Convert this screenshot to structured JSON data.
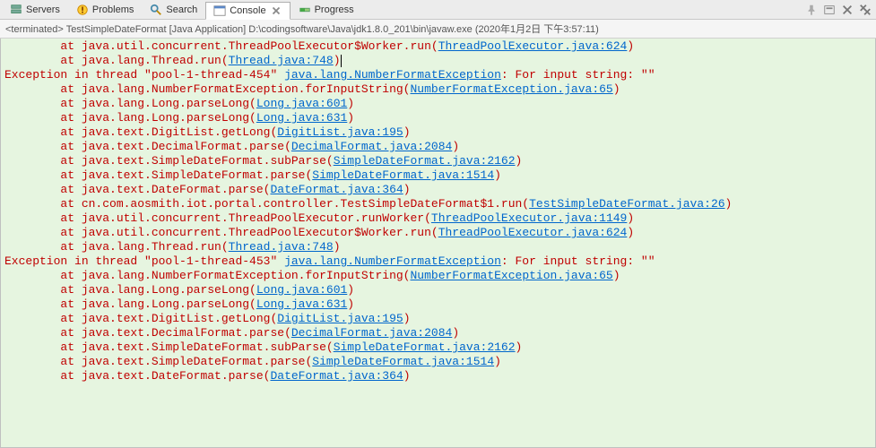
{
  "tabs": [
    {
      "label": "Servers"
    },
    {
      "label": "Problems"
    },
    {
      "label": "Search"
    },
    {
      "label": "Console"
    },
    {
      "label": "Progress"
    }
  ],
  "status": {
    "prefix": "<terminated> ",
    "name": "TestSimpleDateFormat [Java Application]",
    "path": " D:\\codingsoftware\\Java\\jdk1.8.0_201\\bin\\javaw.exe ",
    "time": "(2020年1月2日 下午3:57:11)"
  },
  "lines": [
    {
      "type": "at",
      "indent": 8,
      "method": "java.util.concurrent.ThreadPoolExecutor$Worker.run",
      "link": "ThreadPoolExecutor.java:624"
    },
    {
      "type": "at",
      "indent": 8,
      "method": "java.lang.Thread.run",
      "link": "Thread.java:748",
      "cursor": true
    },
    {
      "type": "ex",
      "thread": "pool-1-thread-454",
      "exClass": "java.lang.NumberFormatException",
      "msg": ": For input string: \"\""
    },
    {
      "type": "at",
      "indent": 8,
      "method": "java.lang.NumberFormatException.forInputString",
      "link": "NumberFormatException.java:65"
    },
    {
      "type": "at",
      "indent": 8,
      "method": "java.lang.Long.parseLong",
      "link": "Long.java:601"
    },
    {
      "type": "at",
      "indent": 8,
      "method": "java.lang.Long.parseLong",
      "link": "Long.java:631"
    },
    {
      "type": "at",
      "indent": 8,
      "method": "java.text.DigitList.getLong",
      "link": "DigitList.java:195"
    },
    {
      "type": "at",
      "indent": 8,
      "method": "java.text.DecimalFormat.parse",
      "link": "DecimalFormat.java:2084"
    },
    {
      "type": "at",
      "indent": 8,
      "method": "java.text.SimpleDateFormat.subParse",
      "link": "SimpleDateFormat.java:2162"
    },
    {
      "type": "at",
      "indent": 8,
      "method": "java.text.SimpleDateFormat.parse",
      "link": "SimpleDateFormat.java:1514"
    },
    {
      "type": "at",
      "indent": 8,
      "method": "java.text.DateFormat.parse",
      "link": "DateFormat.java:364"
    },
    {
      "type": "at",
      "indent": 8,
      "method": "cn.com.aosmith.iot.portal.controller.TestSimpleDateFormat$1.run",
      "link": "TestSimpleDateFormat.java:26"
    },
    {
      "type": "at",
      "indent": 8,
      "method": "java.util.concurrent.ThreadPoolExecutor.runWorker",
      "link": "ThreadPoolExecutor.java:1149"
    },
    {
      "type": "at",
      "indent": 8,
      "method": "java.util.concurrent.ThreadPoolExecutor$Worker.run",
      "link": "ThreadPoolExecutor.java:624"
    },
    {
      "type": "at",
      "indent": 8,
      "method": "java.lang.Thread.run",
      "link": "Thread.java:748"
    },
    {
      "type": "ex",
      "thread": "pool-1-thread-453",
      "exClass": "java.lang.NumberFormatException",
      "msg": ": For input string: \"\""
    },
    {
      "type": "at",
      "indent": 8,
      "method": "java.lang.NumberFormatException.forInputString",
      "link": "NumberFormatException.java:65"
    },
    {
      "type": "at",
      "indent": 8,
      "method": "java.lang.Long.parseLong",
      "link": "Long.java:601"
    },
    {
      "type": "at",
      "indent": 8,
      "method": "java.lang.Long.parseLong",
      "link": "Long.java:631"
    },
    {
      "type": "at",
      "indent": 8,
      "method": "java.text.DigitList.getLong",
      "link": "DigitList.java:195"
    },
    {
      "type": "at",
      "indent": 8,
      "method": "java.text.DecimalFormat.parse",
      "link": "DecimalFormat.java:2084"
    },
    {
      "type": "at",
      "indent": 8,
      "method": "java.text.SimpleDateFormat.subParse",
      "link": "SimpleDateFormat.java:2162"
    },
    {
      "type": "at",
      "indent": 8,
      "method": "java.text.SimpleDateFormat.parse",
      "link": "SimpleDateFormat.java:1514"
    },
    {
      "type": "at",
      "indent": 8,
      "method": "java.text.DateFormat.parse",
      "link": "DateFormat.java:364"
    }
  ],
  "labels": {
    "ex_prefix": "Exception in thread \"",
    "ex_mid": "\" ",
    "at": "at "
  }
}
